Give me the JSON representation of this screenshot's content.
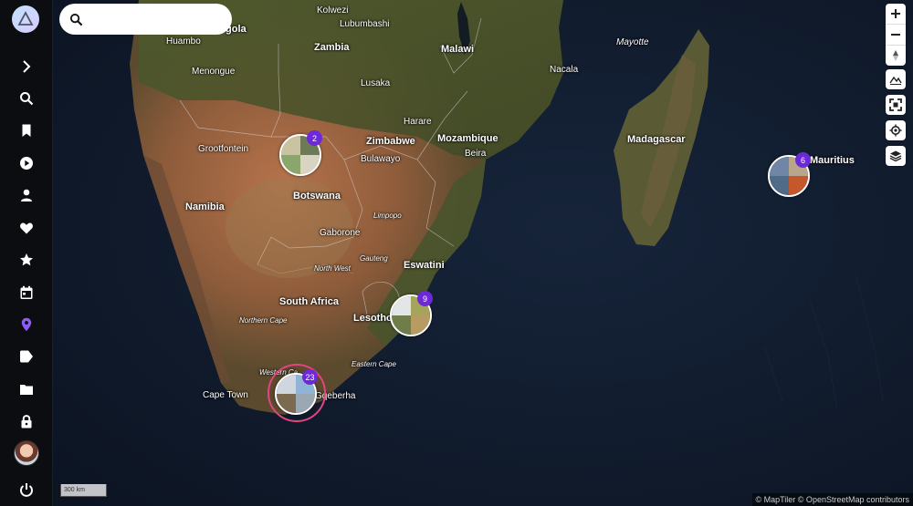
{
  "search": {
    "placeholder": ""
  },
  "sidebar": {
    "items": [
      {
        "name": "expand",
        "icon": "chevron-right-icon"
      },
      {
        "name": "search",
        "icon": "search-icon"
      },
      {
        "name": "bookmarks",
        "icon": "bookmark-icon"
      },
      {
        "name": "videos",
        "icon": "play-circle-icon"
      },
      {
        "name": "people",
        "icon": "person-icon"
      },
      {
        "name": "favorites",
        "icon": "heart-icon"
      },
      {
        "name": "starred",
        "icon": "star-icon"
      },
      {
        "name": "calendar",
        "icon": "calendar-icon"
      },
      {
        "name": "places",
        "icon": "map-pin-icon",
        "active": true
      },
      {
        "name": "labels",
        "icon": "tag-icon"
      },
      {
        "name": "folders",
        "icon": "folder-icon"
      },
      {
        "name": "private",
        "icon": "lock-icon"
      },
      {
        "name": "logout",
        "icon": "power-icon"
      }
    ],
    "accent_color": "#8b5cf6"
  },
  "map": {
    "places": {
      "kolwezi": "Kolwezi",
      "lubumbashi": "Lubumbashi",
      "huambo": "Huambo",
      "angola": "gola",
      "zambia": "Zambia",
      "malawi": "Malawi",
      "mayotte": "Mayotte",
      "menongue": "Menongue",
      "nacala": "Nacala",
      "lusaka": "Lusaka",
      "harare": "Harare",
      "zimbabwe": "Zimbabwe",
      "mozambique": "Mozambique",
      "madagascar": "Madagascar",
      "grootfontein": "Grootfontein",
      "bulawayo": "Bulawayo",
      "beira": "Beira",
      "mauritius": "Mauritius",
      "namibia": "Namibia",
      "botswana": "Botswana",
      "limpopo": "Limpopo",
      "gaborone": "Gaborone",
      "gauteng": "Gauteng",
      "north_west": "North West",
      "eswatini": "Eswatini",
      "south_africa": "South Africa",
      "lesotho": "Lesotho",
      "northern_cape": "Northern Cape",
      "eastern_cape": "Eastern Cape",
      "western_cape": "Western Ca",
      "gqeberha": "Gqeberha",
      "cape_town": "Cape Town"
    },
    "clusters": [
      {
        "name": "cluster-botswana",
        "count": "2"
      },
      {
        "name": "cluster-mauritius",
        "count": "6"
      },
      {
        "name": "cluster-kwazulu",
        "count": "9"
      },
      {
        "name": "cluster-gqeberha",
        "count": "23",
        "selected": true
      }
    ],
    "badge_color": "#6d28d9",
    "selection_ring_color": "#e3447e",
    "scale_label": "300 km",
    "attribution": "© MapTiler © OpenStreetMap contributors"
  }
}
